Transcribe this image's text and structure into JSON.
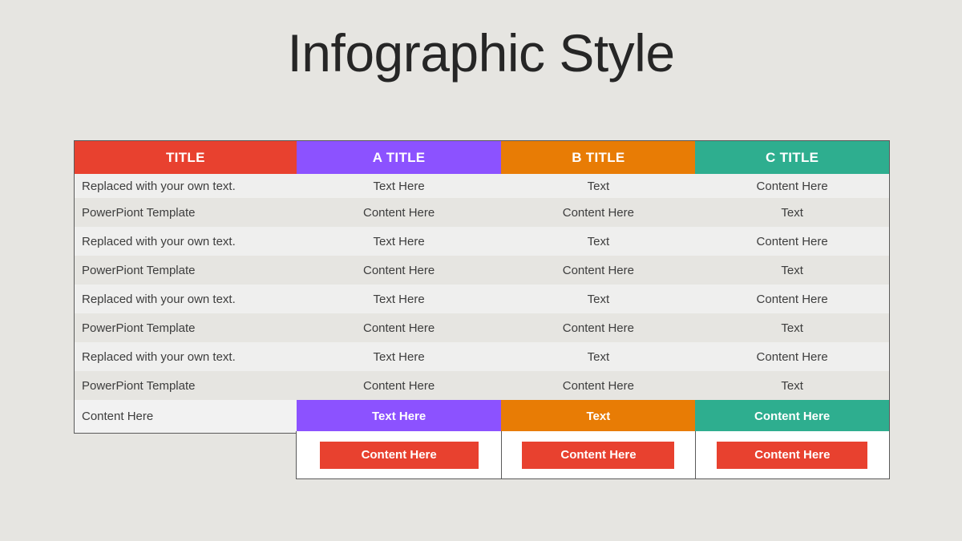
{
  "slide": {
    "title": "Infographic Style"
  },
  "colors": {
    "title_col": "#e8412f",
    "a": "#8c52ff",
    "b": "#e87c05",
    "c": "#2eae8f",
    "button": "#e8412f"
  },
  "table": {
    "headers": [
      "TITLE",
      "A TITLE",
      "B TITLE",
      "C TITLE"
    ],
    "rows": [
      [
        "Replaced with your own text.",
        "Text  Here",
        "Text",
        "Content Here"
      ],
      [
        "PowerPiont Template",
        "Content Here",
        "Content Here",
        "Text"
      ],
      [
        "Replaced with your own text.",
        "Text  Here",
        "Text",
        "Content Here"
      ],
      [
        "PowerPiont Template",
        "Content Here",
        "Content Here",
        "Text"
      ],
      [
        "Replaced with your own text.",
        "Text  Here",
        "Text",
        "Content Here"
      ],
      [
        "PowerPiont Template",
        "Content Here",
        "Content Here",
        "Text"
      ],
      [
        "Replaced with your own text.",
        "Text  Here",
        "Text",
        "Content Here"
      ],
      [
        "PowerPiont Template",
        "Content Here",
        "Content Here",
        "Text"
      ]
    ],
    "footer": [
      "Content Here",
      "Text Here",
      "Text",
      "Content Here"
    ]
  },
  "buttons": [
    "Content Here",
    "Content Here",
    "Content Here"
  ]
}
